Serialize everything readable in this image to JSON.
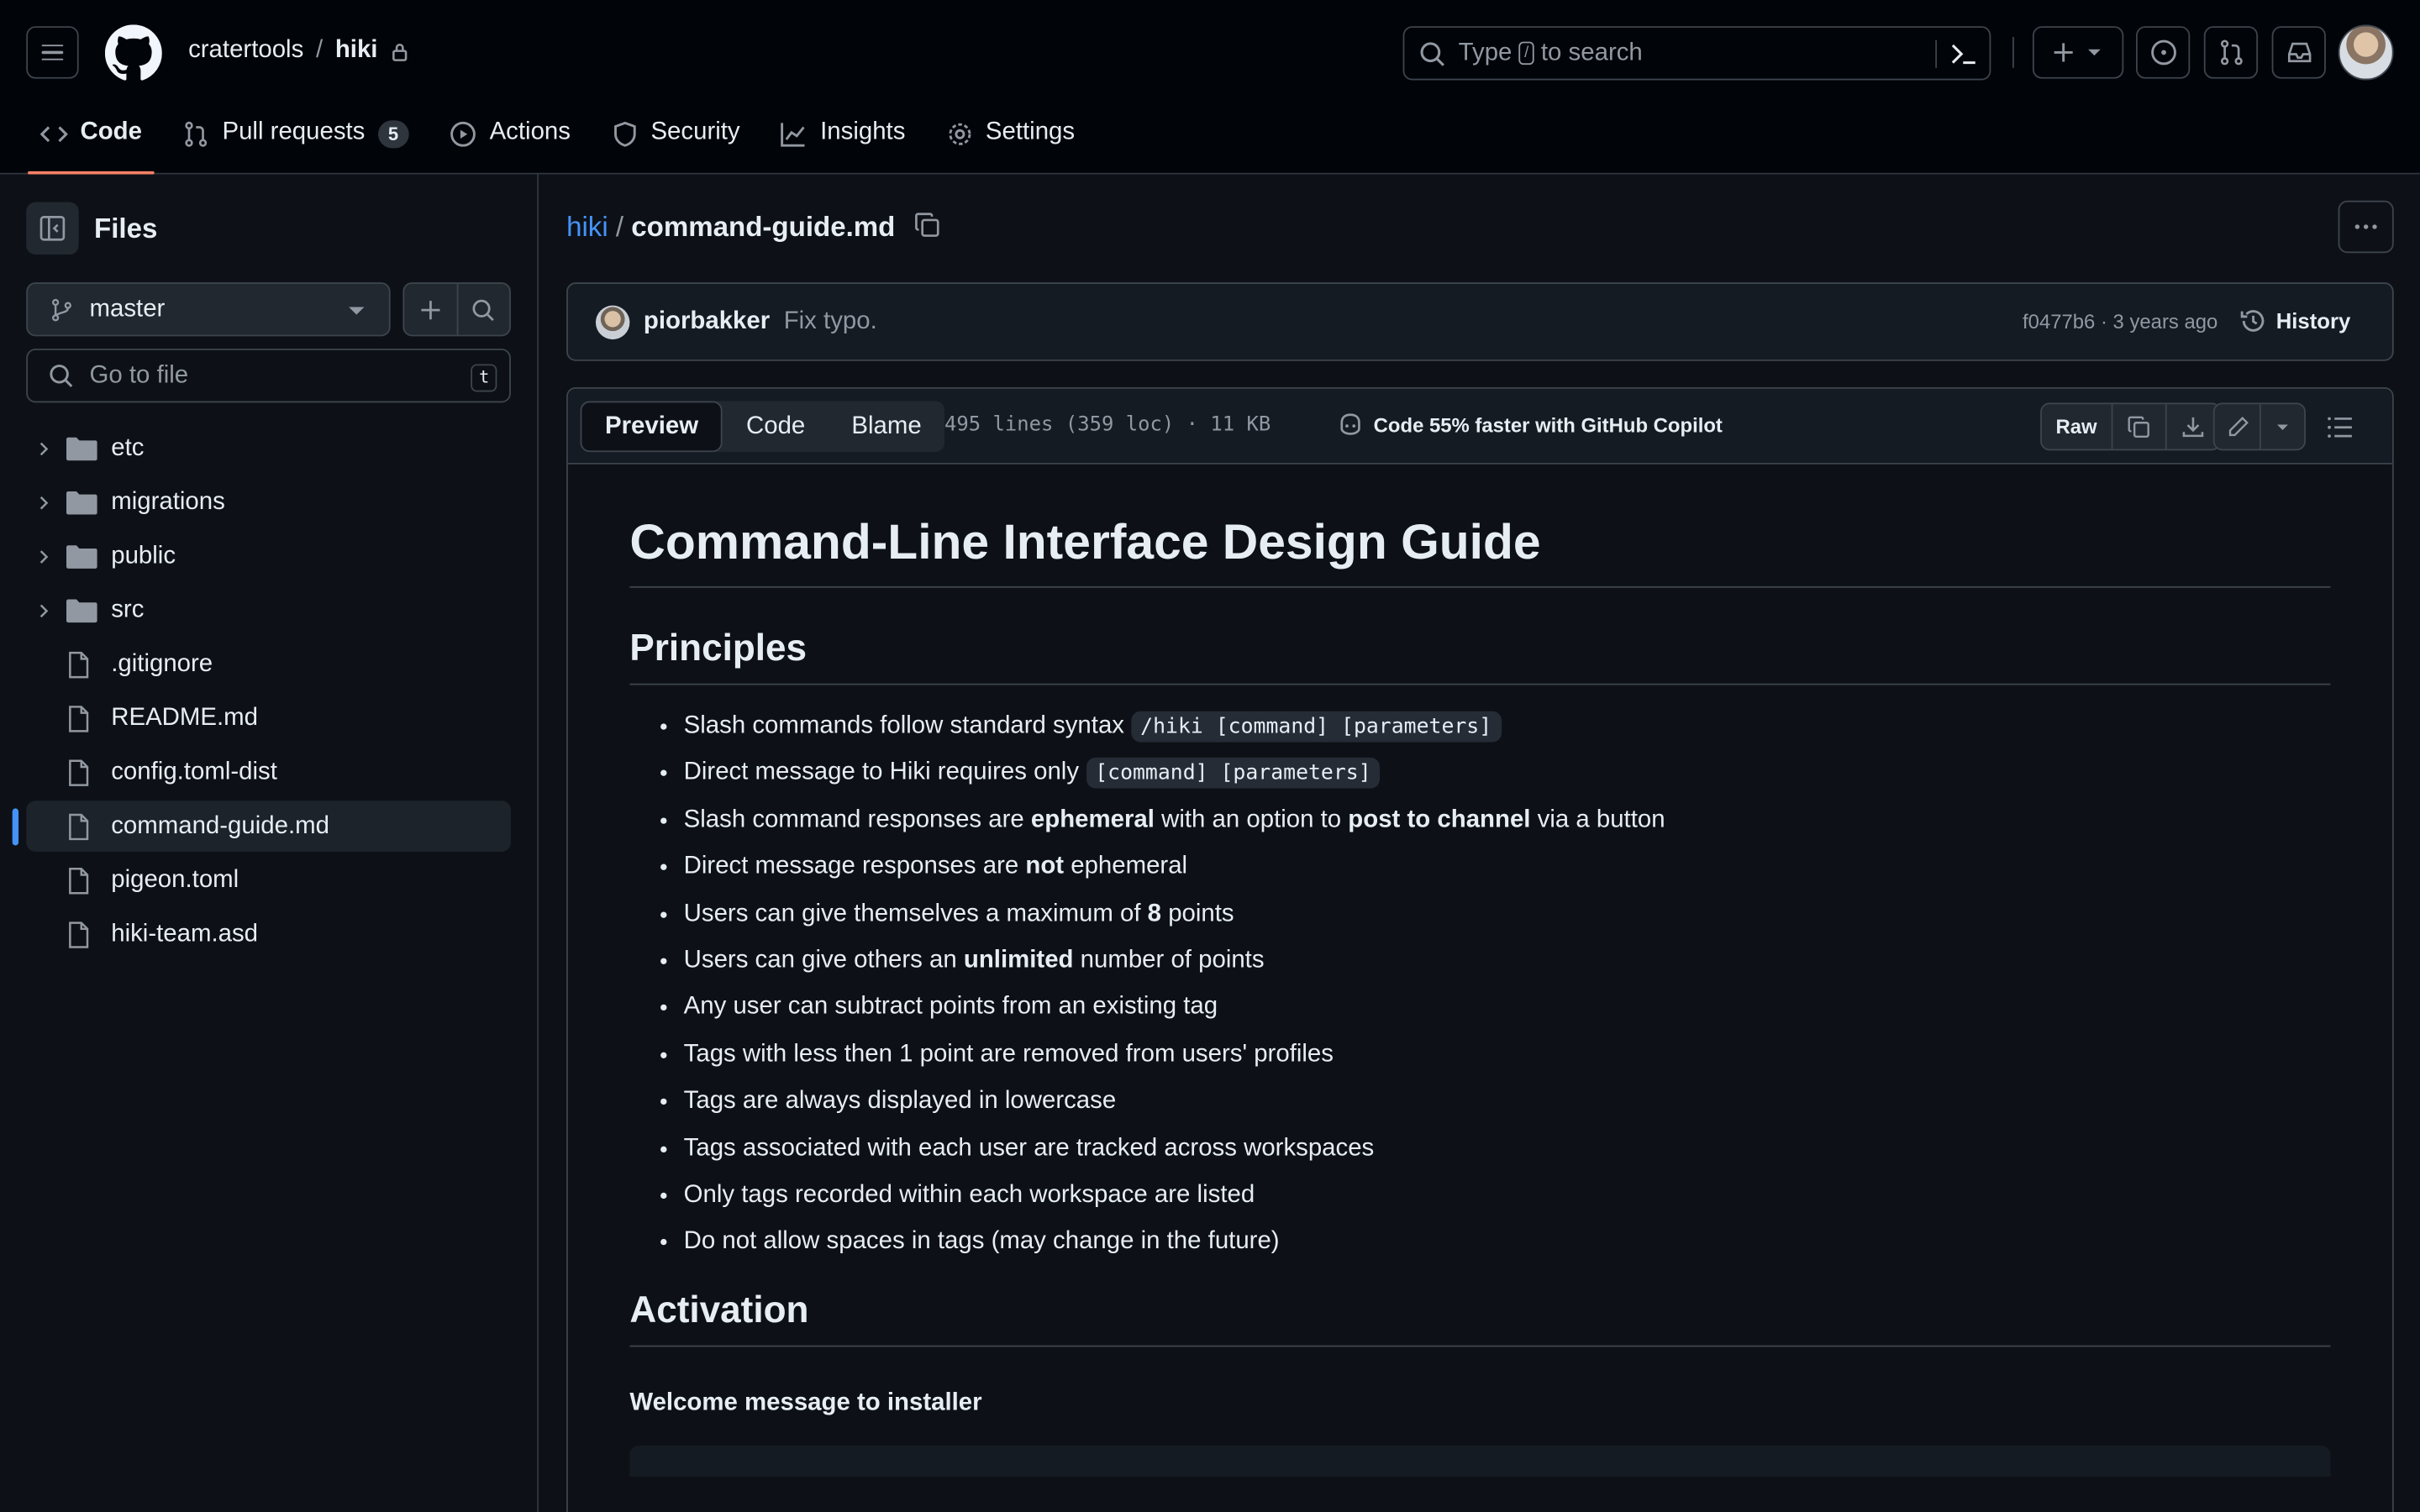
{
  "header": {
    "owner": "cratertools",
    "separator": "/",
    "repo": "hiki",
    "search_prefix": "Type",
    "search_key": "/",
    "search_suffix": "to search"
  },
  "repo_nav": {
    "code": "Code",
    "pull_requests": "Pull requests",
    "pull_requests_count": "5",
    "actions": "Actions",
    "security": "Security",
    "insights": "Insights",
    "settings": "Settings"
  },
  "sidebar": {
    "title": "Files",
    "branch": "master",
    "goto_placeholder": "Go to file",
    "goto_key": "t",
    "items": [
      {
        "label": "etc",
        "type": "folder"
      },
      {
        "label": "migrations",
        "type": "folder"
      },
      {
        "label": "public",
        "type": "folder"
      },
      {
        "label": "src",
        "type": "folder"
      },
      {
        "label": ".gitignore",
        "type": "file"
      },
      {
        "label": "README.md",
        "type": "file"
      },
      {
        "label": "config.toml-dist",
        "type": "file"
      },
      {
        "label": "command-guide.md",
        "type": "file",
        "selected": true
      },
      {
        "label": "pigeon.toml",
        "type": "file"
      },
      {
        "label": "hiki-team.asd",
        "type": "file"
      }
    ]
  },
  "breadcrumb": {
    "repo": "hiki",
    "separator": "/",
    "file": "command-guide.md"
  },
  "commit": {
    "author": "piorbakker",
    "message": "Fix typo.",
    "meta": "f0477b6 · 3 years ago",
    "history": "History"
  },
  "file_toolbar": {
    "tabs": [
      "Preview",
      "Code",
      "Blame"
    ],
    "info": "495 lines (359 loc) · 11 KB",
    "copilot": "Code 55% faster with GitHub Copilot",
    "raw": "Raw"
  },
  "markdown": {
    "h1": "Command-Line Interface Design Guide",
    "h2_principles": "Principles",
    "principles": [
      {
        "pre": "Slash commands follow standard syntax ",
        "code": "/hiki [command] [parameters]"
      },
      {
        "pre": "Direct message to Hiki requires only ",
        "code": "[command] [parameters]"
      },
      {
        "pre": "Slash command responses are ",
        "b1": "ephemeral",
        "mid": " with an option to ",
        "b2": "post to channel",
        "post": " via a button"
      },
      {
        "pre": "Direct message responses are ",
        "b1": "not",
        "post": " ephemeral"
      },
      {
        "pre": "Users can give themselves a maximum of ",
        "b1": "8",
        "post": " points"
      },
      {
        "pre": "Users can give others an ",
        "b1": "unlimited",
        "post": " number of points"
      },
      {
        "pre": "Any user can subtract points from an existing tag"
      },
      {
        "pre": "Tags with less then 1 point are removed from users' profiles"
      },
      {
        "pre": "Tags are always displayed in lowercase"
      },
      {
        "pre": "Tags associated with each user are tracked across workspaces"
      },
      {
        "pre": "Only tags recorded within each workspace are listed"
      },
      {
        "pre": "Do not allow spaces in tags (may change in the future)"
      }
    ],
    "h2_activation": "Activation",
    "h4_welcome": "Welcome message to installer"
  },
  "colors": {
    "accent_link": "#4493f8",
    "active_tab_underline": "#f78166",
    "background": "#0d1117"
  }
}
